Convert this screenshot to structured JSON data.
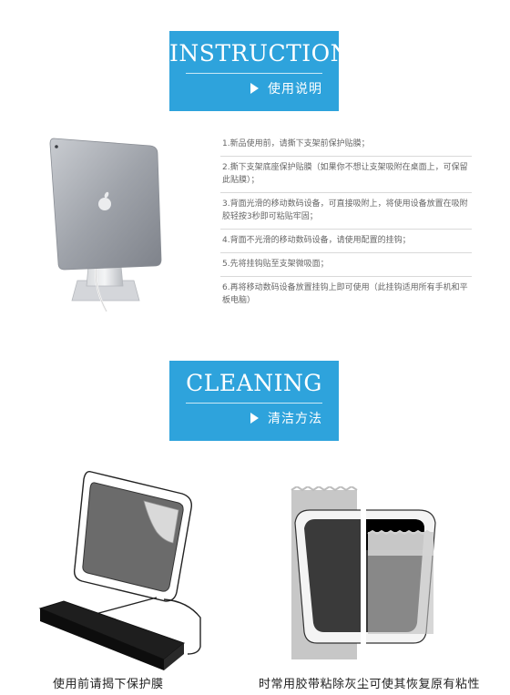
{
  "instructions": {
    "title": "INSTRUCTIONS",
    "subtitle": "使用说明",
    "steps": [
      "1.新品使用前，请撕下支架前保护贴膜；",
      "2.撕下支架底座保护贴膜（如果你不想让支架吸附在桌面上，可保留此贴膜）；",
      "3.背面光滑的移动数码设备，可直接吸附上，将使用设备放置在吸附胶轻按3秒即可粘贴牢固；",
      "4.背面不光滑的移动数码设备，请使用配置的挂钩；",
      "5.先将挂钩贴至支架微吸面；",
      "6.再将移动数码设备放置挂钩上即可使用（此挂钩适用所有手机和平板电脑）"
    ]
  },
  "cleaning": {
    "title": "CLEANING",
    "subtitle": "清洁方法",
    "caption_left": "使用前请揭下保护膜",
    "caption_right": "时常用胶带粘除灰尘可使其恢复原有粘性"
  },
  "colors": {
    "accent": "#2ea3dc"
  },
  "icons": {
    "arrow": "play-triangle-icon"
  }
}
